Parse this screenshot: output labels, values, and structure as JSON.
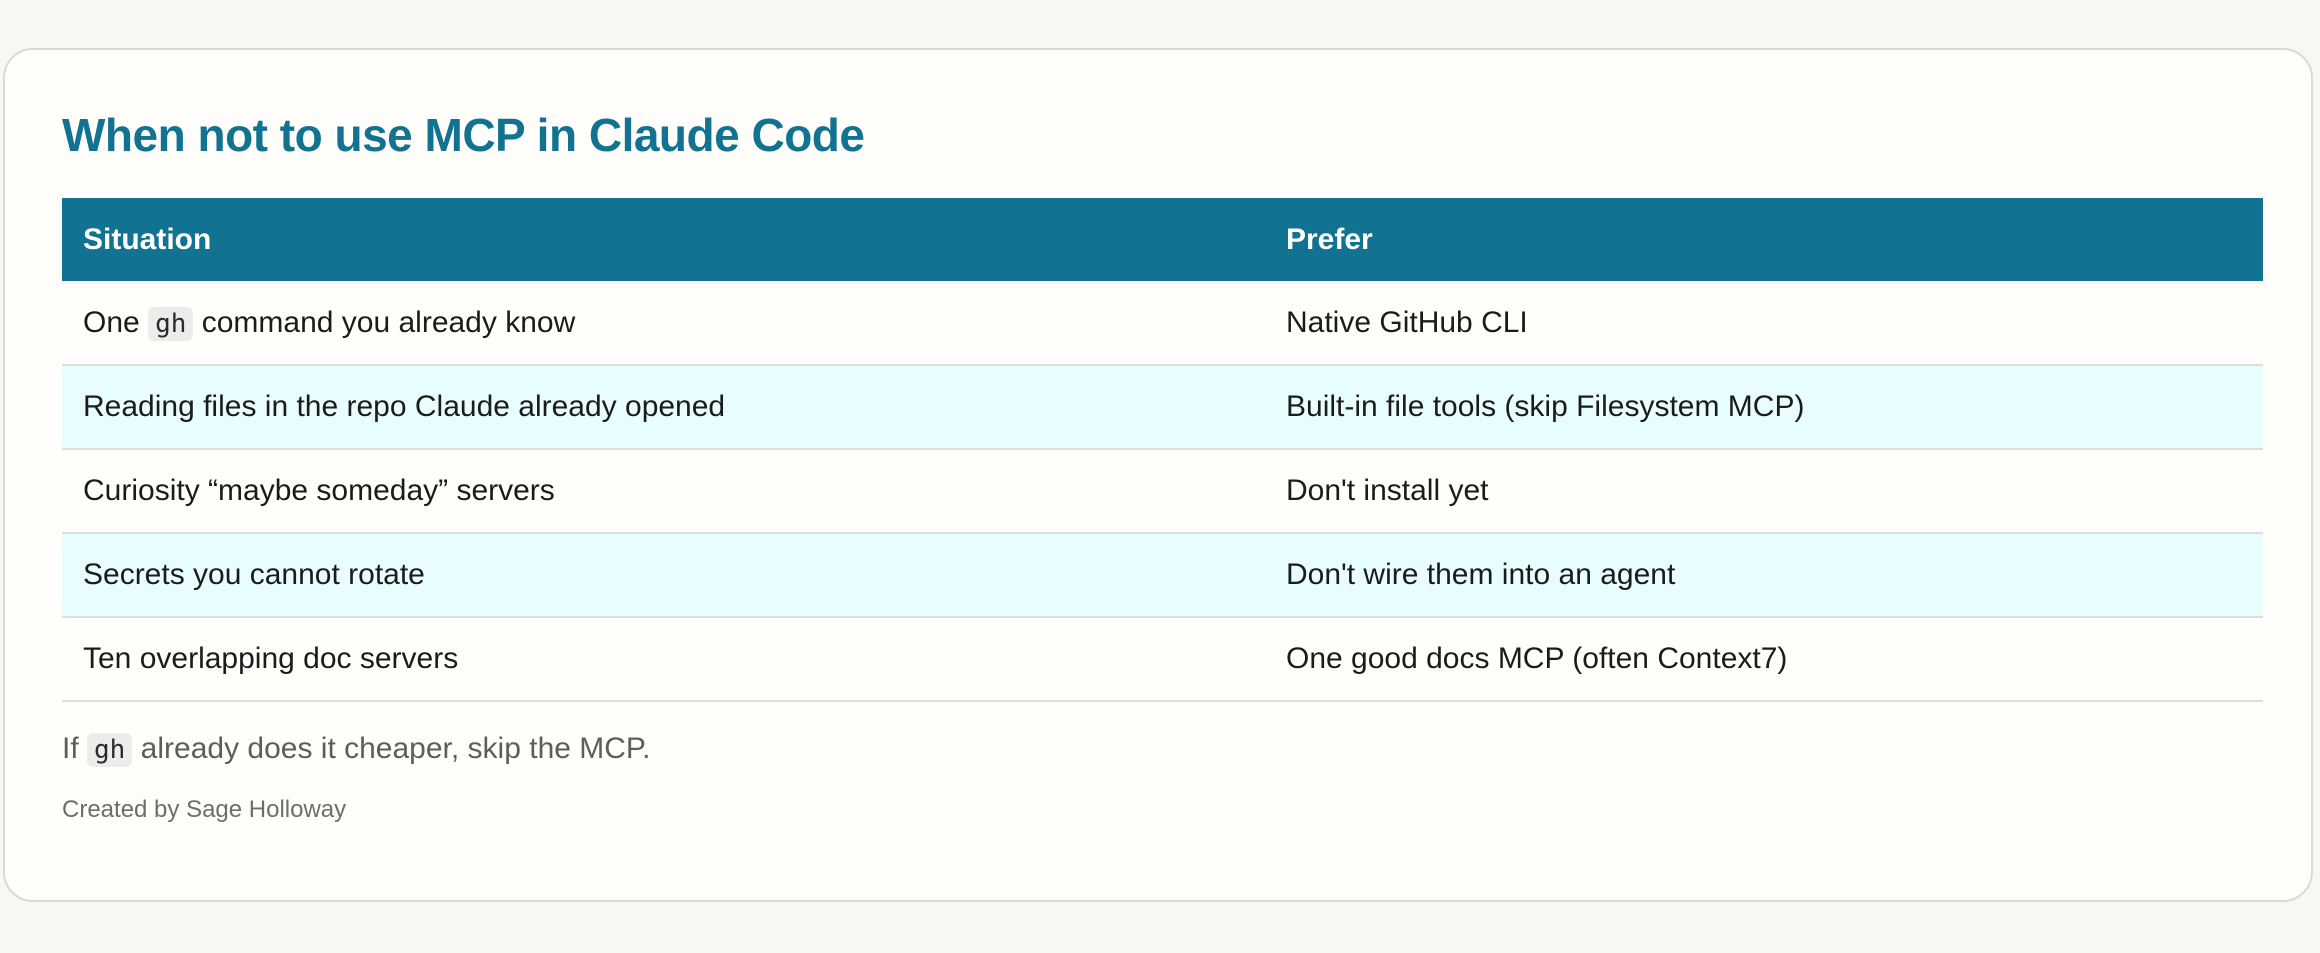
{
  "title": "When not to use MCP in Claude Code",
  "table": {
    "headers": [
      "Situation",
      "Prefer"
    ],
    "rows": [
      {
        "situation_before": "One",
        "situation_code": "gh",
        "situation_after": "command you already know",
        "prefer": "Native GitHub CLI"
      },
      {
        "situation": "Reading files in the repo Claude already opened",
        "prefer": "Built-in file tools (skip Filesystem MCP)"
      },
      {
        "situation": "Curiosity “maybe someday” servers",
        "prefer": "Don't install yet"
      },
      {
        "situation": "Secrets you cannot rotate",
        "prefer": "Don't wire them into an agent"
      },
      {
        "situation": "Ten overlapping doc servers",
        "prefer": "One good docs MCP (often Context7)"
      }
    ]
  },
  "note": {
    "before": "If",
    "code": "gh",
    "after": "already does it cheaper, skip the MCP."
  },
  "credit": "Created by Sage Holloway",
  "colors": {
    "accent": "#117391",
    "row_alt": "#e8fefe",
    "background": "#f9f7f2",
    "card": "#fffefa"
  }
}
